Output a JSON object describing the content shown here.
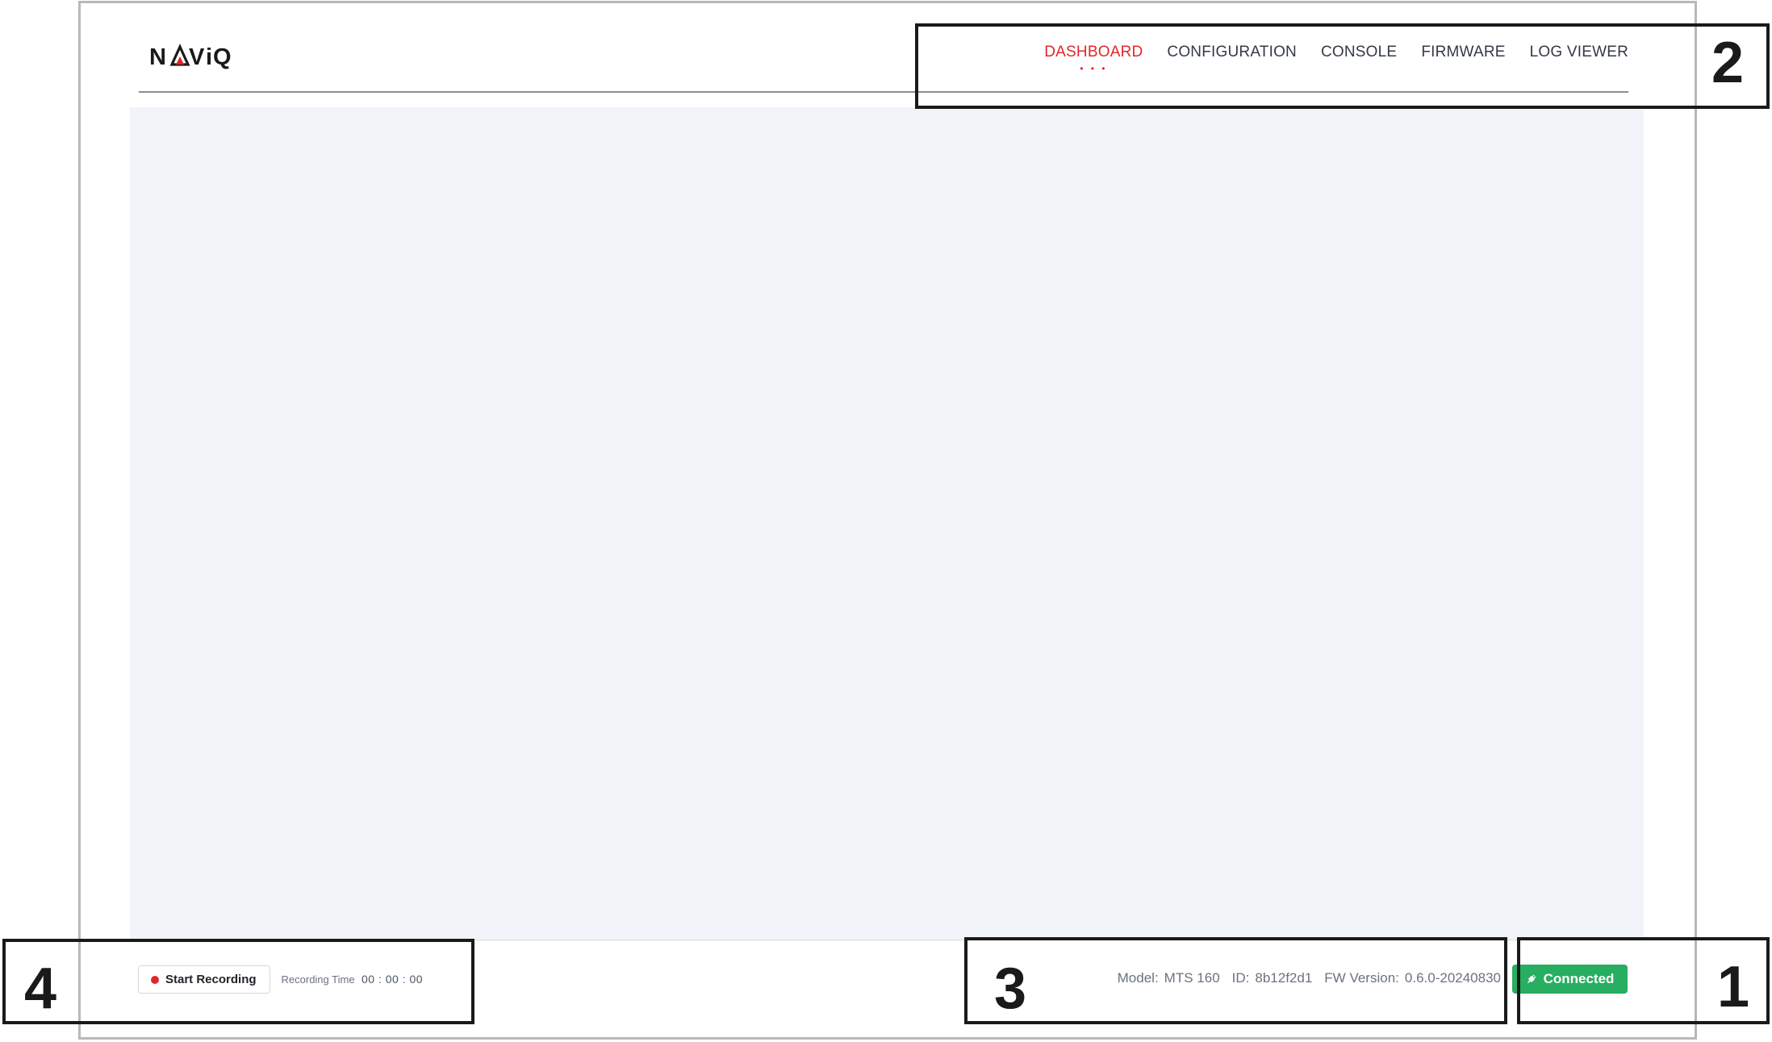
{
  "app": {
    "brand": "NAViQ"
  },
  "nav": {
    "items": [
      {
        "label": "DASHBOARD",
        "active": true
      },
      {
        "label": "CONFIGURATION",
        "active": false
      },
      {
        "label": "CONSOLE",
        "active": false
      },
      {
        "label": "FIRMWARE",
        "active": false
      },
      {
        "label": "LOG VIEWER",
        "active": false
      }
    ],
    "active_indicator": "• • •"
  },
  "footer": {
    "record_button_label": "Start Recording",
    "recording_time_label": "Recording Time",
    "recording_time_value": "00 : 00 : 00",
    "model_label": "Model:",
    "model_value": "MTS 160",
    "id_label": "ID:",
    "id_value": "8b12f2d1",
    "fw_label": "FW Version:",
    "fw_value": "0.6.0-20240830",
    "status_label": "Connected",
    "status_icon": "plug-icon"
  },
  "callouts": [
    "1",
    "2",
    "3",
    "4"
  ],
  "colors": {
    "accent": "#e0262a",
    "connected": "#27ae60",
    "content_bg": "#f1f4f8",
    "text": "#333a45"
  }
}
